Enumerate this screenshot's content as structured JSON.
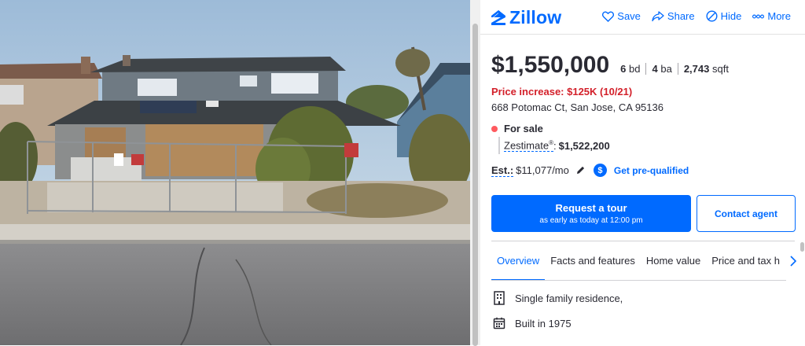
{
  "brand": {
    "name": "Zillow",
    "color": "#006aff"
  },
  "actions": [
    {
      "label": "Save",
      "icon": "heart-icon"
    },
    {
      "label": "Share",
      "icon": "share-icon"
    },
    {
      "label": "Hide",
      "icon": "hide-icon"
    },
    {
      "label": "More",
      "icon": "more-icon"
    }
  ],
  "listing": {
    "price": "$1,550,000",
    "beds_num": "6",
    "beds_unit": "bd",
    "baths_num": "4",
    "baths_unit": "ba",
    "sqft_num": "2,743",
    "sqft_unit": "sqft",
    "price_change": "Price increase: $125K (10/21)",
    "address": "668 Potomac Ct, San Jose, CA 95136",
    "status": "For sale",
    "zestimate_label": "Zestimate",
    "zestimate_sup": "®",
    "zestimate_colon": ":",
    "zestimate_value": "$1,522,200",
    "est_label": "Est.:",
    "est_value": "$11,077/mo",
    "prequal": "Get pre-qualified",
    "dollar_symbol": "$"
  },
  "buttons": {
    "tour_main": "Request a tour",
    "tour_sub": "as early as today at 12:00 pm",
    "contact": "Contact agent"
  },
  "tabs": [
    "Overview",
    "Facts and features",
    "Home value",
    "Price and tax h"
  ],
  "overview": [
    {
      "icon": "building-icon",
      "text": "Single family residence,"
    },
    {
      "icon": "calendar-icon",
      "text": "Built in 1975"
    }
  ]
}
